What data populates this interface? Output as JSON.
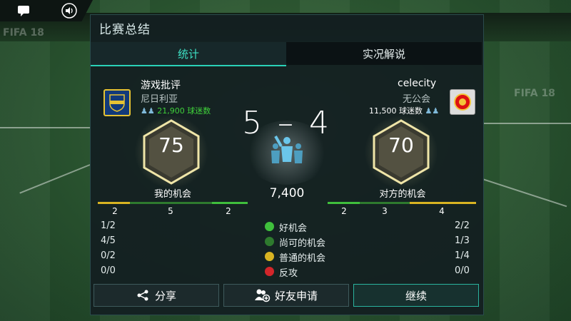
{
  "panel": {
    "title": "比赛总结"
  },
  "tabs": [
    {
      "label": "统计",
      "active": true
    },
    {
      "label": "实况解说",
      "active": false
    }
  ],
  "home": {
    "name": "游戏批评",
    "country": "尼日利亚",
    "fans": "21,900 球迷数",
    "rating": "75",
    "chances_label": "我的机会",
    "bar_values": [
      "2",
      "5",
      "2"
    ]
  },
  "away": {
    "name": "celecity",
    "country": "无公会",
    "fans": "11,500 球迷数",
    "rating": "70",
    "chances_label": "对方的机会",
    "bar_values": [
      "2",
      "3",
      "4"
    ]
  },
  "match": {
    "score": "5 – 4",
    "attendance": "7,400"
  },
  "stats": [
    {
      "label": "好机会",
      "home": "1/2",
      "away": "2/2",
      "color": "#3fbf3c"
    },
    {
      "label": "尚可的机会",
      "home": "4/5",
      "away": "1/3",
      "color": "#2e7a2e"
    },
    {
      "label": "普通的机会",
      "home": "0/2",
      "away": "1/4",
      "color": "#d9b422"
    },
    {
      "label": "反攻",
      "home": "0/0",
      "away": "0/0",
      "color": "#d3262a"
    }
  ],
  "buttons": {
    "share": "分享",
    "friend": "好友申请",
    "continue": "继续"
  },
  "colors": {
    "accent": "#2ad1b7",
    "fans_home": "#3fd13a",
    "bar_green_dark": "#2e7a2e",
    "bar_green": "#3fbf3c",
    "bar_yellow": "#d9b422"
  }
}
